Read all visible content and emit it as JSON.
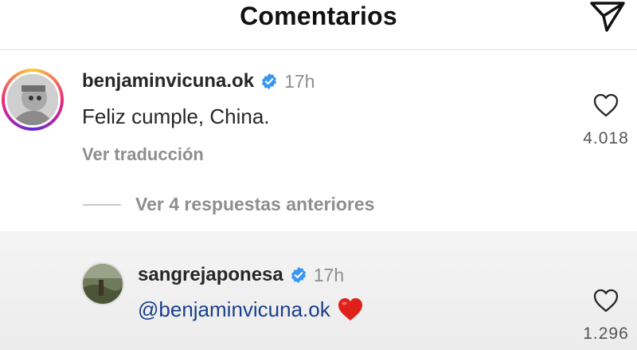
{
  "header": {
    "title": "Comentarios",
    "send_icon": "send-icon"
  },
  "comment": {
    "username": "benjaminvicuna.ok",
    "time": "17h",
    "text": "Feliz cumple, China.",
    "translate_label": "Ver traducción",
    "likes": "4.018"
  },
  "replies_toggle": {
    "label": "Ver 4 respuestas anteriores"
  },
  "reply": {
    "username": "sangrejaponesa",
    "time": "17h",
    "mention": "@benjaminvicuna.ok",
    "emoji": "❤️",
    "likes": "1.296"
  },
  "colors": {
    "verified": "#3897f0",
    "mention": "#1a3f8a",
    "emoji": "#e0201b"
  }
}
